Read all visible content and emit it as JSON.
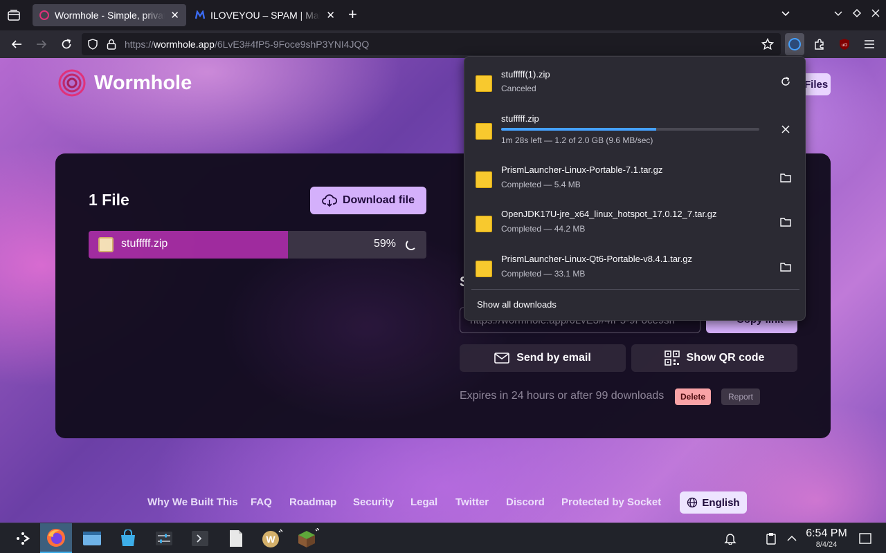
{
  "browser": {
    "tabs": [
      {
        "title": "Wormhole - Simple, private file sharing",
        "active": true
      },
      {
        "title": "ILOVEYOU – SPAM | Malware",
        "active": false
      }
    ],
    "url": {
      "scheme": "https://",
      "host": "wormhole.app",
      "path": "/6LvE3#4fP5-9Foce9shP3YNI4JQQ"
    }
  },
  "page": {
    "logo_text": "Wormhole",
    "files_button_label": "Files",
    "card": {
      "title": "1 File",
      "download_button_label": "Download file",
      "file": {
        "name": "stufffff.zip",
        "percent_label": "59%",
        "progress": 0.59
      },
      "share_heading_partial": "S",
      "link_value": "https://wormhole.app/6LvE3#4fP5-9Foce9sh",
      "copy_link_label": "Copy link",
      "send_email_label": "Send by email",
      "show_qr_label": "Show QR code",
      "expires_text": "Expires in 24 hours or after 99 downloads",
      "delete_label": "Delete",
      "report_label": "Report"
    },
    "footer": {
      "links": [
        "Why We Built This",
        "FAQ",
        "Roadmap",
        "Security",
        "Legal",
        "Twitter",
        "Discord",
        "Protected by Socket"
      ],
      "language_label": "English"
    }
  },
  "downloads_panel": {
    "items": [
      {
        "name": "stufffff(1).zip",
        "status": "Canceled",
        "action_icon": "retry-icon"
      },
      {
        "name": "stufffff.zip",
        "status": "1m 28s left — 1.2 of 2.0 GB (9.6 MB/sec)",
        "progress": 0.6,
        "action_icon": "cancel-icon"
      },
      {
        "name": "PrismLauncher-Linux-Portable-7.1.tar.gz",
        "status": "Completed — 5.4 MB",
        "action_icon": "folder-icon"
      },
      {
        "name": "OpenJDK17U-jre_x64_linux_hotspot_17.0.12_7.tar.gz",
        "status": "Completed — 44.2 MB",
        "action_icon": "folder-icon"
      },
      {
        "name": "PrismLauncher-Linux-Qt6-Portable-v8.4.1.tar.gz",
        "status": "Completed — 33.1 MB",
        "action_icon": "folder-icon"
      }
    ],
    "show_all_label": "Show all downloads"
  },
  "taskbar": {
    "apps": [
      "application-launcher-icon",
      "firefox-icon",
      "file-manager-icon",
      "discover-store-icon",
      "system-settings-icon",
      "terminal-icon",
      "text-editor-icon",
      "wormhole-app-icon",
      "minecraft-icon"
    ],
    "time": "6:54 PM",
    "date": "8/4/24"
  },
  "colors": {
    "accent_purple": "#d8b4fe",
    "progress_magenta": "#a12b9e",
    "download_progress_blue": "#45a1ff",
    "delete_red": "#fca5a5"
  }
}
